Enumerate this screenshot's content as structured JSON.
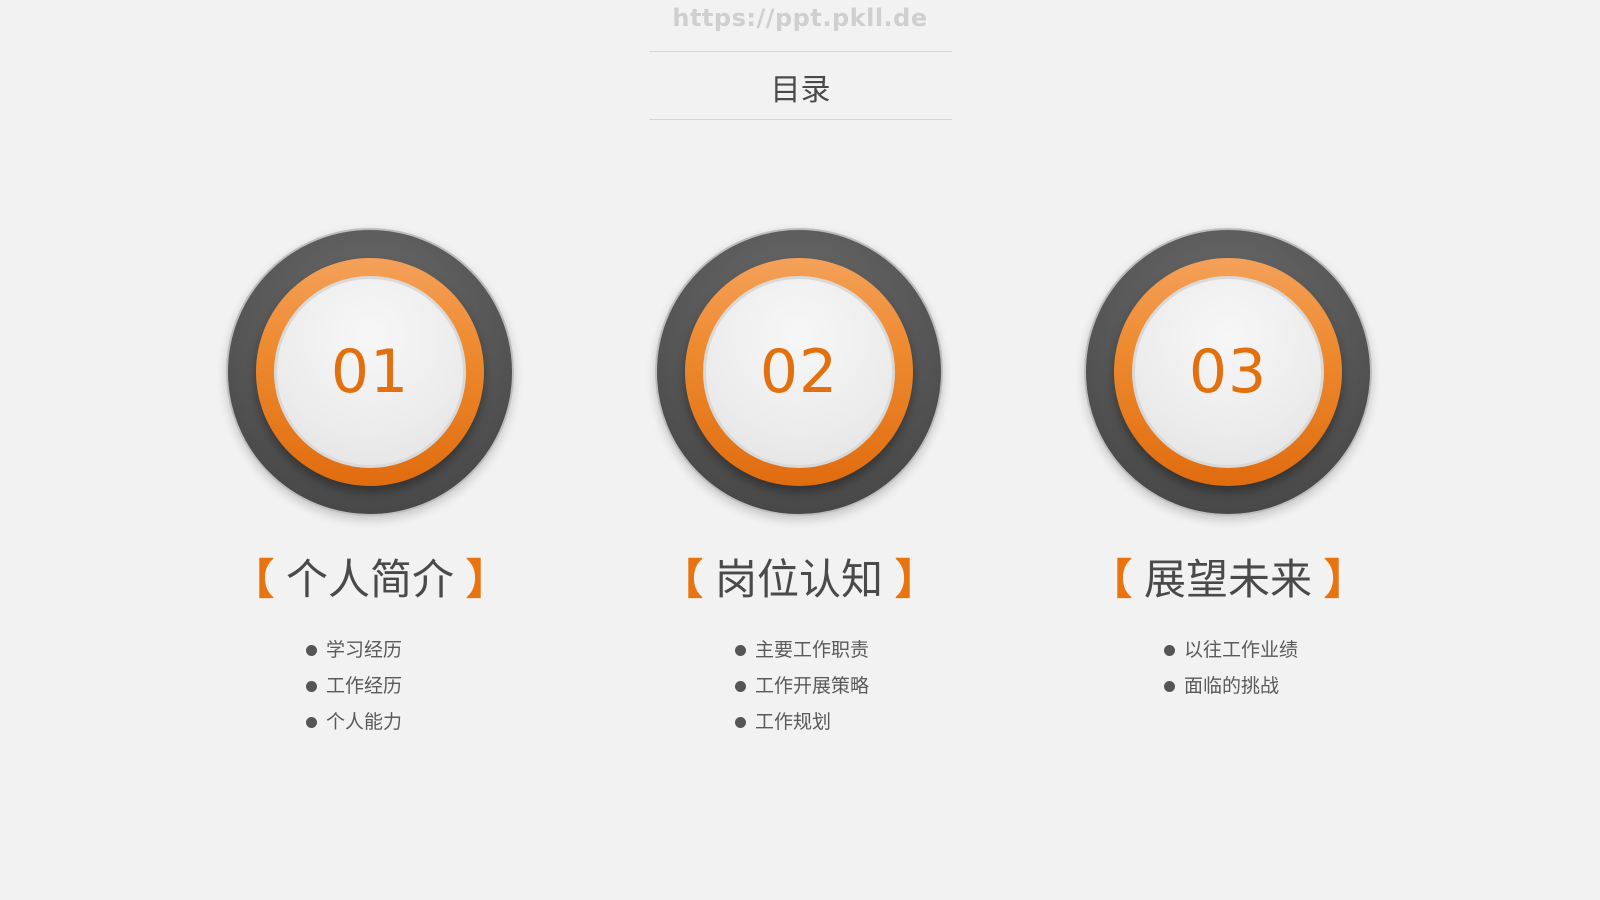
{
  "watermark": "https://ppt.pkll.de",
  "title": "目录",
  "sections": [
    {
      "number": "01",
      "heading": "个人简介",
      "items": [
        "学习经历",
        "工作经历",
        "个人能力"
      ]
    },
    {
      "number": "02",
      "heading": "岗位认知",
      "items": [
        "主要工作职责",
        "工作开展策略",
        "工作规划"
      ]
    },
    {
      "number": "03",
      "heading": "展望未来",
      "items": [
        "以往工作业绩",
        "面临的挑战"
      ]
    }
  ],
  "bracket_open": "【",
  "bracket_close": "】",
  "colors": {
    "accent": "#e8730f",
    "ring_dark": "#555555",
    "background": "#f2f2f2",
    "text": "#4a4a4a"
  }
}
